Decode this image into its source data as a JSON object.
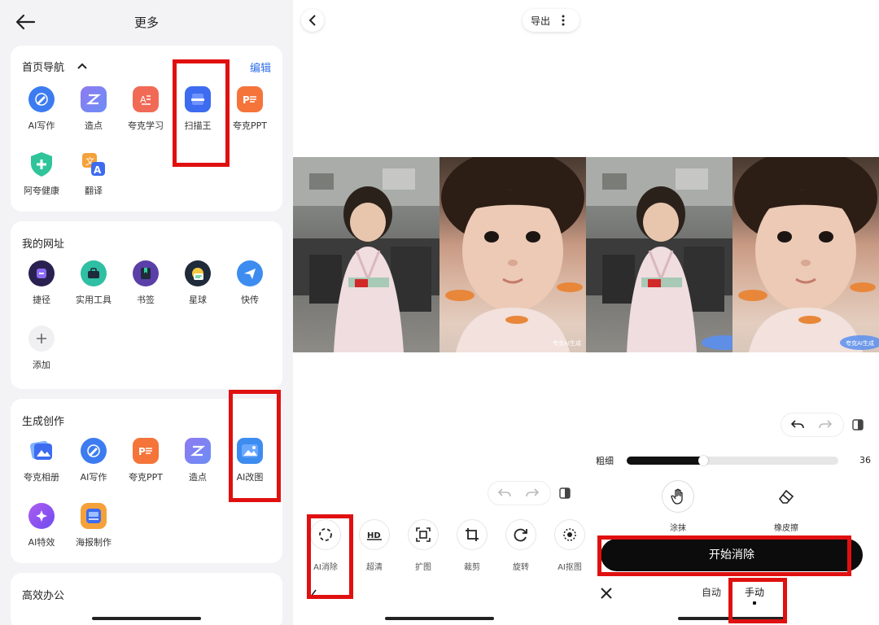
{
  "colors": {
    "highlight": "#e01010",
    "link": "#2f6ee8",
    "panel_bg": "#f3f3f5",
    "button_dark": "#0c0c0c"
  },
  "panel1": {
    "title": "更多",
    "nav": {
      "title": "首页导航",
      "edit": "编辑",
      "apps": [
        {
          "label": "AI写作",
          "icon": "ai-pen-icon"
        },
        {
          "label": "造点",
          "icon": "zaodian-icon"
        },
        {
          "label": "夸克学习",
          "icon": "study-icon"
        },
        {
          "label": "扫描王",
          "icon": "scanner-icon"
        },
        {
          "label": "夸克PPT",
          "icon": "ppt-icon"
        },
        {
          "label": "阿夸健康",
          "icon": "health-shield-icon"
        },
        {
          "label": "翻译",
          "icon": "translate-icon"
        }
      ]
    },
    "sites": {
      "title": "我的网址",
      "apps": [
        {
          "label": "捷径",
          "icon": "shortcut-icon"
        },
        {
          "label": "实用工具",
          "icon": "toolbox-icon"
        },
        {
          "label": "书签",
          "icon": "bookmark-icon"
        },
        {
          "label": "星球",
          "icon": "planet-icon"
        },
        {
          "label": "快传",
          "icon": "send-icon"
        },
        {
          "label": "添加",
          "icon": "plus-icon"
        }
      ]
    },
    "create": {
      "title": "生成创作",
      "apps": [
        {
          "label": "夸克相册",
          "icon": "album-icon"
        },
        {
          "label": "AI写作",
          "icon": "ai-pen-icon"
        },
        {
          "label": "夸克PPT",
          "icon": "ppt-icon"
        },
        {
          "label": "造点",
          "icon": "zaodian-icon"
        },
        {
          "label": "AI改图",
          "icon": "ai-image-edit-icon"
        },
        {
          "label": "AI特效",
          "icon": "effects-icon"
        },
        {
          "label": "海报制作",
          "icon": "poster-icon"
        }
      ]
    },
    "office": {
      "title": "高效办公"
    }
  },
  "panel2": {
    "export": "导出",
    "watermark": "夸克AI生成",
    "tools": [
      {
        "label": "AI消除",
        "icon": "ai-erase-icon"
      },
      {
        "label": "超清",
        "icon": "hd-icon"
      },
      {
        "label": "扩图",
        "icon": "expand-icon"
      },
      {
        "label": "裁剪",
        "icon": "crop-icon"
      },
      {
        "label": "旋转",
        "icon": "rotate-icon"
      },
      {
        "label": "AI抠图",
        "icon": "cutout-icon"
      }
    ]
  },
  "panel3": {
    "watermark": "夸克AI生成",
    "brush": {
      "label": "粗细",
      "value": "36",
      "fraction": 0.36
    },
    "modes": [
      {
        "label": "涂抹",
        "icon": "hand-smear-icon"
      },
      {
        "label": "橡皮擦",
        "icon": "eraser-icon"
      }
    ],
    "start": "开始消除",
    "tabs": {
      "auto": "自动",
      "manual": "手动"
    }
  }
}
